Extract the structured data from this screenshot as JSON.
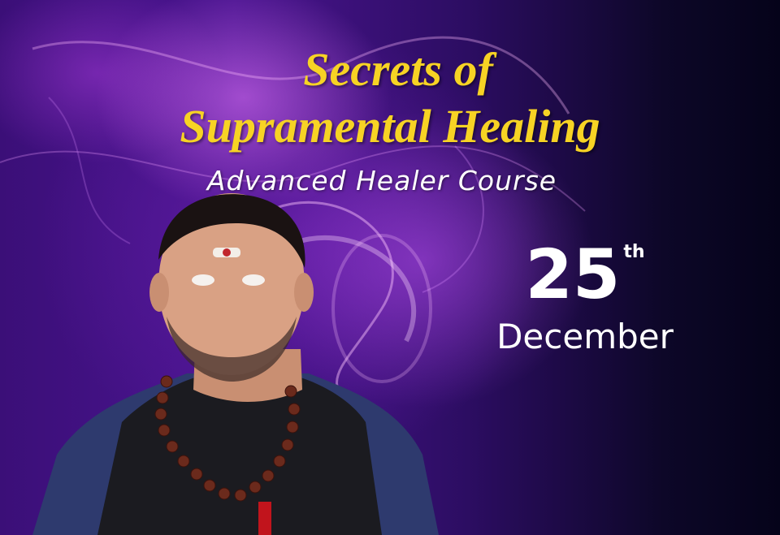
{
  "banner": {
    "title_line1": "Secrets of",
    "title_line2": "Supramental Healing",
    "subtitle": "Advanced Healer Course",
    "date_day": "25",
    "date_suffix": "th",
    "date_month": "December"
  },
  "colors": {
    "title": "#f7d324",
    "text": "#ffffff",
    "background_left": "#4a1490",
    "background_right": "#05031a"
  }
}
